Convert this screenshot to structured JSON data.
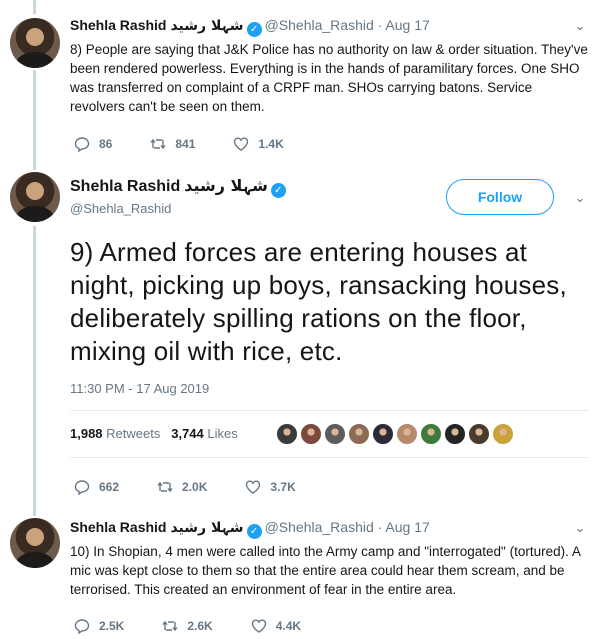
{
  "tweets": [
    {
      "name": "Shehla Rashid",
      "urdu_name": "شہلا رشید",
      "handle": "@Shehla_Rashid",
      "date": "Aug 17",
      "text": "8) People are saying that J&K Police has no authority on law & order situation. They've been rendered powerless. Everything is in the hands of paramilitary forces. One SHO was transferred on complaint of a CRPF man. SHOs carrying batons. Service revolvers can't be seen on them.",
      "replies": "86",
      "retweets": "841",
      "likes": "1.4K"
    },
    {
      "name": "Shehla Rashid",
      "urdu_name": "شہلا رشید",
      "handle": "@Shehla_Rashid",
      "follow_label": "Follow",
      "text": "9) Armed forces are entering houses at night, picking up boys, ransacking houses, deliberately spilling rations on the floor, mixing oil with rice, etc.",
      "timestamp": "11:30 PM - 17 Aug 2019",
      "retweet_count": "1,988",
      "retweet_label": "Retweets",
      "like_count": "3,744",
      "like_label": "Likes",
      "replies": "662",
      "retweets": "2.0K",
      "likes": "3.7K"
    },
    {
      "name": "Shehla Rashid",
      "urdu_name": "شہلا رشید",
      "handle": "@Shehla_Rashid",
      "date": "Aug 17",
      "text": "10) In Shopian, 4 men were called into the Army camp and \"interrogated\" (tortured). A mic was kept close to them so that the entire area could hear them scream, and be terrorised. This created an environment of fear in the entire area.",
      "replies": "2.5K",
      "retweets": "2.6K",
      "likes": "4.4K"
    }
  ],
  "liker_colors": [
    "#3b3b3b",
    "#7a4b3c",
    "#5d5d5d",
    "#8b6b55",
    "#2d2a3a",
    "#b58a6d",
    "#3f7a3a",
    "#242424",
    "#4a3b2f",
    "#c9a33a"
  ],
  "colors": {
    "accent": "#1da1f2",
    "muted": "#657786",
    "text": "#14171a"
  }
}
